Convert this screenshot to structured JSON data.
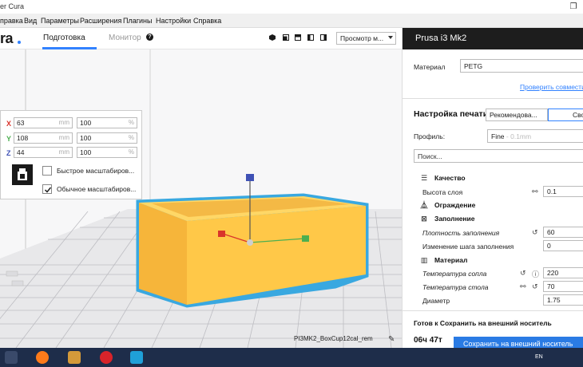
{
  "window": {
    "title": "er Cura"
  },
  "menu": [
    "правка",
    "Вид",
    "Параметры",
    "Расширения",
    "Плагины",
    "Настройки",
    "Справка"
  ],
  "header": {
    "logo": "ra",
    "tabs": {
      "prepare": "Подготовка",
      "monitor": "Монитор"
    },
    "view_select": "Просмотр м..."
  },
  "scale": {
    "x": {
      "label": "X",
      "mm": "63",
      "mm_unit": "mm",
      "percent": "100",
      "percent_unit": "%",
      "color": "#d9342b"
    },
    "y": {
      "label": "Y",
      "mm": "108",
      "mm_unit": "mm",
      "percent": "100",
      "percent_unit": "%",
      "color": "#4caf50"
    },
    "z": {
      "label": "Z",
      "mm": "44",
      "mm_unit": "mm",
      "percent": "100",
      "percent_unit": "%",
      "color": "#3f51b5"
    },
    "quick_scale": "Быстрое масштабиров...",
    "uniform_scale": "Обычное масштабиров...",
    "uniform_checked": true
  },
  "model": {
    "color": "#ffc848",
    "outline": "#39a8e0"
  },
  "filename": "PI3MK2_BoxCup12cal_rem",
  "printer": {
    "name": "Prusa i3 Mk2"
  },
  "material": {
    "label": "Материал",
    "value": "PETG",
    "compat_link": "Проверить совмести"
  },
  "print_settings": {
    "title": "Настройка печати",
    "recommended": "Рекомендова...",
    "custom": "Свои",
    "profile_label": "Профиль:",
    "profile_value": "Fine",
    "profile_suffix": "- 0.1mm",
    "search_placeholder": "Поиск..."
  },
  "sections": {
    "quality": "Качество",
    "layer_height_label": "Высота слоя",
    "layer_height_value": "0.1",
    "shell": "Ограждение",
    "infill": "Заполнение",
    "infill_density_label": "Плотность заполнения",
    "infill_density_value": "60",
    "gradual_label": "Изменение шага заполнения",
    "gradual_value": "0",
    "material": "Материал",
    "nozzle_temp_label": "Температура сопла",
    "nozzle_temp_value": "220",
    "bed_temp_label": "Температура стола",
    "bed_temp_value": "70",
    "diameter_label": "Диаметр",
    "diameter_value": "1.75"
  },
  "footer": {
    "ready": "Готов к Сохранить на внешний носитель",
    "time": "06ч 47т",
    "save_button": "Сохранить на внешний носитель"
  },
  "taskbar": {
    "lang": "EN"
  }
}
